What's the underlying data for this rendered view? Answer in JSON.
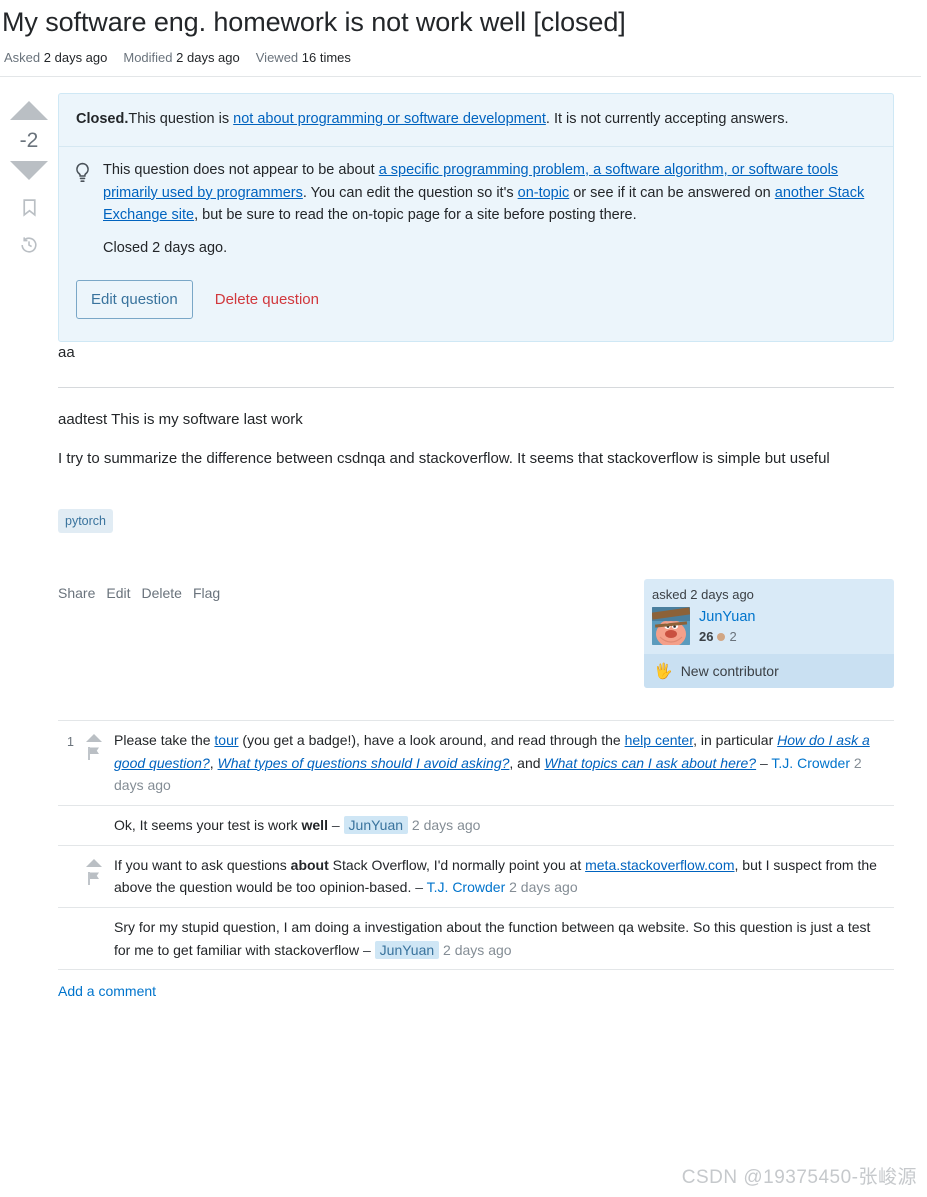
{
  "question": {
    "title": "My software eng. homework is not work well [closed]",
    "meta": [
      {
        "key": "Asked",
        "value": "2 days ago"
      },
      {
        "key": "Modified",
        "value": "2 days ago"
      },
      {
        "key": "Viewed",
        "value": "16 times"
      }
    ],
    "vote_count": "-2",
    "icons": {
      "upvote": "upvote-arrow-icon",
      "downvote": "downvote-arrow-icon",
      "bookmark": "bookmark-icon",
      "history": "history-clock-icon"
    }
  },
  "notice": {
    "closed_label": "Closed.",
    "closed_text_1": "This question is ",
    "closed_link": "not about programming or software development",
    "closed_text_2": ". It is not currently accepting answers.",
    "bulb_icon": "lightbulb-icon",
    "reason_text_1": "This question does not appear to be about ",
    "reason_link_1": "a specific programming problem, a software algorithm, or software tools primarily used by programmers",
    "reason_text_2": ". You can edit the question so it's ",
    "reason_link_2": "on-topic",
    "reason_text_3": " or see if it can be answered on ",
    "reason_link_3": "another Stack Exchange site",
    "reason_text_4": ", but be sure to read the on-topic page for a site before posting there.",
    "closed_when": "Closed 2 days ago.",
    "edit_button": "Edit question",
    "delete_button": "Delete question",
    "colors": {
      "background": "#ecf5fb",
      "border": "#cfe8f5",
      "link": "#0063bf",
      "edit_button_text": "#39739d",
      "delete_button_text": "#d1383d"
    }
  },
  "post": {
    "intro": "aa",
    "paragraph_1": "aadtest This is my software last work",
    "paragraph_2": "I try to summarize the difference between csdnqa and stackoverflow. It seems that stackoverflow is simple but useful",
    "tags": [
      "pytorch"
    ],
    "actions": [
      "Share",
      "Edit",
      "Delete",
      "Flag"
    ]
  },
  "user_card": {
    "action": "asked 2 days ago",
    "avatar_name": "user-avatar",
    "username": "JunYuan",
    "reputation": "26",
    "bronze_badge_count": "2",
    "contributor_label": "New contributor",
    "hand_icon": "waving-hand-icon",
    "colors": {
      "card_background": "#d9eaf7",
      "contributor_background": "#c9e0f2",
      "bronze": "#d1a684"
    }
  },
  "comments": [
    {
      "score": "1",
      "has_vote_icons": true,
      "parts": [
        {
          "t": "text",
          "v": "Please take the "
        },
        {
          "t": "link",
          "v": "tour"
        },
        {
          "t": "text",
          "v": " (you get a badge!), have a look around, and read through the "
        },
        {
          "t": "link",
          "v": "help center"
        },
        {
          "t": "text",
          "v": ", in particular "
        },
        {
          "t": "link-italic",
          "v": "How do I ask a good question?"
        },
        {
          "t": "text",
          "v": ", "
        },
        {
          "t": "link-italic",
          "v": "What types of questions should I avoid asking?"
        },
        {
          "t": "text",
          "v": ", and "
        },
        {
          "t": "link-italic",
          "v": "What topics can I ask about here?"
        },
        {
          "t": "dash",
          "v": " – "
        },
        {
          "t": "user",
          "v": "T.J. Crowder"
        },
        {
          "t": "date",
          "v": " 2 days ago"
        }
      ]
    },
    {
      "score": "",
      "has_vote_icons": false,
      "parts": [
        {
          "t": "text",
          "v": "Ok, It seems your test is work "
        },
        {
          "t": "bold",
          "v": "well"
        },
        {
          "t": "dash",
          "v": " – "
        },
        {
          "t": "user-op",
          "v": "JunYuan"
        },
        {
          "t": "date",
          "v": " 2 days ago"
        }
      ]
    },
    {
      "score": "",
      "has_vote_icons": true,
      "parts": [
        {
          "t": "text",
          "v": "If you want to ask questions "
        },
        {
          "t": "bold",
          "v": "about"
        },
        {
          "t": "text",
          "v": " Stack Overflow, I'd normally point you at "
        },
        {
          "t": "link",
          "v": "meta.stackoverflow.com"
        },
        {
          "t": "text",
          "v": ", but I suspect from the above the question would be too opinion-based."
        },
        {
          "t": "dash",
          "v": " – "
        },
        {
          "t": "user",
          "v": "T.J. Crowder"
        },
        {
          "t": "date",
          "v": " 2 days ago"
        }
      ]
    },
    {
      "score": "",
      "has_vote_icons": false,
      "parts": [
        {
          "t": "text",
          "v": "Sry for my stupid question, I am doing a investigation about the function between qa website. So this question is just a test for me to get familiar with stackoverflow"
        },
        {
          "t": "dash",
          "v": " – "
        },
        {
          "t": "user-op",
          "v": "JunYuan"
        },
        {
          "t": "date",
          "v": " 2 days ago"
        }
      ]
    }
  ],
  "add_comment_label": "Add a comment",
  "watermark": "CSDN @19375450-张峻源"
}
